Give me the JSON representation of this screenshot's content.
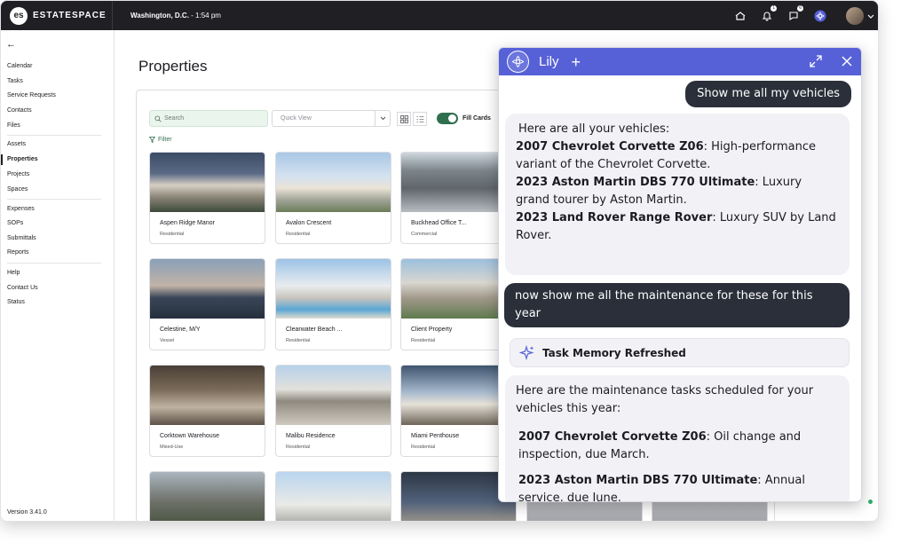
{
  "topbar": {
    "logo_mark": "es",
    "logo_text": "ESTATESPACE",
    "location": "Washington, D.C.",
    "time": " - 1:54 pm",
    "notifications_count": "1",
    "messages_count": "6",
    "icons": [
      "home-icon",
      "bell-icon",
      "chat-icon",
      "lily-icon",
      "avatar",
      "chevron-down-icon"
    ]
  },
  "sidebar": {
    "back_icon": "←",
    "groups": [
      [
        "Calendar",
        "Tasks",
        "Service Requests",
        "Contacts",
        "Files"
      ],
      [
        "Assets",
        "Properties",
        "Projects",
        "Spaces"
      ],
      [
        "Expenses",
        "SOPs",
        "Submittals",
        "Reports"
      ],
      [
        "Help",
        "Contact Us",
        "Status"
      ]
    ],
    "active": "Properties",
    "version": "Version 3.41.0"
  },
  "main": {
    "title": "Properties",
    "search_placeholder": "Search",
    "quick_view_placeholder": "Quick View",
    "fill_cards_label": "Fill Cards",
    "filter_label": "Filter",
    "cards": [
      {
        "name": "Aspen Ridge Manor",
        "type": "Residential"
      },
      {
        "name": "Avalon Crescent",
        "type": "Residential"
      },
      {
        "name": "Buckhead Office T...",
        "type": "Commercial"
      },
      {
        "name": "Celestine, M/Y",
        "type": "Vessel"
      },
      {
        "name": "Clearwater Beach ...",
        "type": "Residential"
      },
      {
        "name": "Client Property",
        "type": "Residential"
      },
      {
        "name": "Corktown Warehouse",
        "type": "Mixed-Use"
      },
      {
        "name": "Malibu Residence",
        "type": "Residential"
      },
      {
        "name": "Miami Penthouse",
        "type": "Residential"
      }
    ]
  },
  "chat": {
    "title": "Lily",
    "plus": "+",
    "messages": {
      "user1": "Show me all my vehicles",
      "bot1_intro": "Here are all your vehicles:",
      "bot1_items": [
        {
          "bold": "2007 Chevrolet Corvette Z06",
          "text": ": High-performance variant of the Chevrolet Corvette."
        },
        {
          "bold": "2023 Aston Martin DBS 770 Ultimate",
          "text": ": Luxury grand tourer by Aston Martin."
        },
        {
          "bold": "2023 Land Rover Range Rover",
          "text": ": Luxury SUV by Land Rover."
        }
      ],
      "user2": "now show me all the maintenance for these for this year",
      "memory": "Task Memory Refreshed",
      "bot2_intro": "Here are the maintenance tasks scheduled for your vehicles this year:",
      "bot2_items": [
        {
          "bold": "2007 Chevrolet Corvette Z06",
          "text": ": Oil change and inspection, due March."
        },
        {
          "bold": "2023 Aston Martin DBS 770 Ultimate",
          "text": ": Annual service, due June."
        }
      ]
    }
  },
  "colors": {
    "topbar": "#1f1f24",
    "chat_header": "#5661d8",
    "user_bubble": "#2a2f3a",
    "accent_green": "#2f6f4e"
  }
}
